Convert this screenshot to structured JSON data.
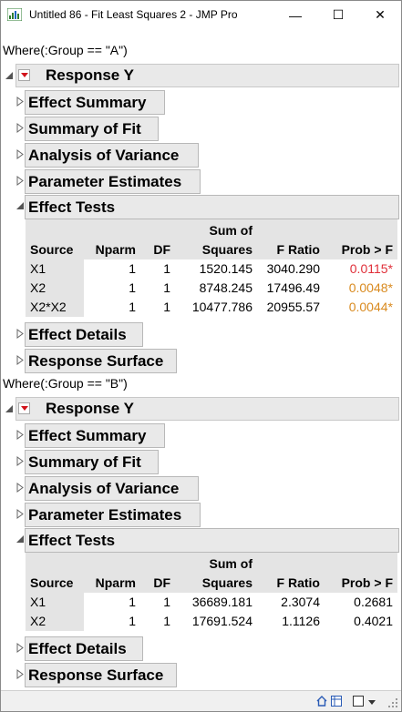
{
  "window": {
    "title": "Untitled 86 - Fit Least Squares 2 - JMP Pro",
    "minimize_glyph": "—",
    "maximize_glyph": "☐",
    "close_glyph": "✕"
  },
  "groups": [
    {
      "where": "Where(:Group == \"A\")",
      "response_title": "Response Y",
      "collapsed_outlines": [
        "Effect Summary",
        "Summary of Fit",
        "Analysis of Variance",
        "Parameter Estimates"
      ],
      "effect_tests_title": "Effect Tests",
      "columns": [
        "Source",
        "Nparm",
        "DF",
        "Sum of",
        "Squares",
        "F Ratio",
        "Prob > F"
      ],
      "rows": [
        {
          "source": "X1",
          "nparm": "1",
          "df": "1",
          "ss": "1520.145",
          "f": "3040.290",
          "p": "0.0115*"
        },
        {
          "source": "X2",
          "nparm": "1",
          "df": "1",
          "ss": "8748.245",
          "f": "17496.49",
          "p": "0.0048*"
        },
        {
          "source": "X2*X2",
          "nparm": "1",
          "df": "1",
          "ss": "10477.786",
          "f": "20955.57",
          "p": "0.0044*"
        }
      ],
      "trailing_outlines": [
        "Effect Details",
        "Response Surface"
      ]
    },
    {
      "where": "Where(:Group == \"B\")",
      "response_title": "Response Y",
      "collapsed_outlines": [
        "Effect Summary",
        "Summary of Fit",
        "Analysis of Variance",
        "Parameter Estimates"
      ],
      "effect_tests_title": "Effect Tests",
      "columns": [
        "Source",
        "Nparm",
        "DF",
        "Sum of",
        "Squares",
        "F Ratio",
        "Prob > F"
      ],
      "rows": [
        {
          "source": "X1",
          "nparm": "1",
          "df": "1",
          "ss": "36689.181",
          "f": "2.3074",
          "p": "0.2681"
        },
        {
          "source": "X2",
          "nparm": "1",
          "df": "1",
          "ss": "17691.524",
          "f": "1.1126",
          "p": "0.4021"
        }
      ],
      "trailing_outlines": [
        "Effect Details",
        "Response Surface"
      ]
    }
  ],
  "colors": {
    "p_red": "#e0303a",
    "p_orange": "#d98a1f"
  }
}
